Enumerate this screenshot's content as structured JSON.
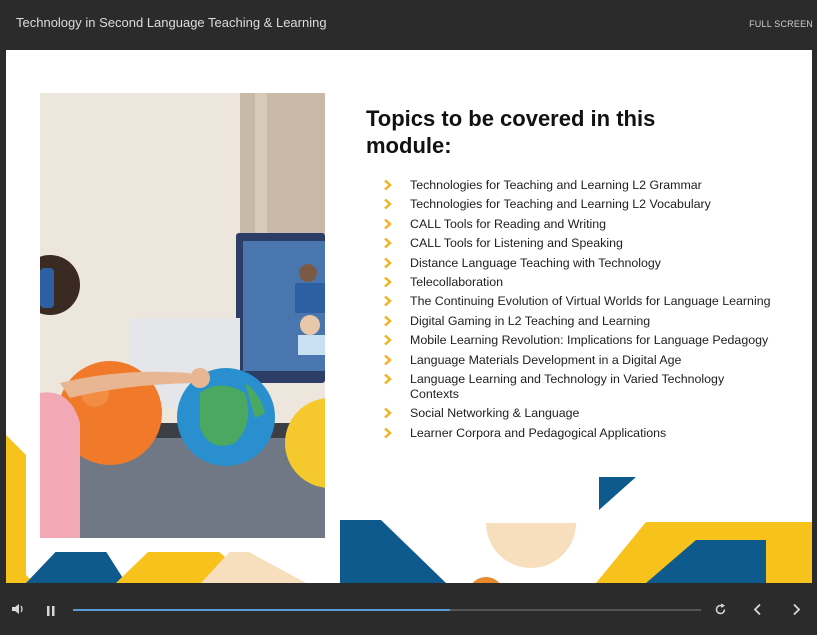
{
  "window": {
    "title": "Technology in Second Language Teaching & Learning",
    "fullscreen_label": "FULL SCREEN"
  },
  "slide": {
    "heading": "Topics to be covered in this module:",
    "topics": [
      "Technologies for Teaching and Learning L2 Grammar",
      "Technologies for Teaching and Learning L2 Vocabulary",
      "CALL Tools for Reading and Writing",
      "CALL Tools for Listening and Speaking",
      "Distance Language Teaching with Technology",
      "Telecollaboration",
      "The Continuing Evolution of Virtual Worlds for Language Learning",
      "Digital Gaming in L2 Teaching and Learning",
      "Mobile Learning Revolution: Implications for Language Pedagogy",
      "Language Materials Development in a Digital Age",
      "Language Learning and Technology in Varied Technology Contexts",
      "Social Networking & Language",
      "Learner Corpora and Pedagogical Applications"
    ],
    "colors": {
      "bullet": "#f2b21b",
      "navy": "#0f5a8c",
      "yellow": "#f7c21c",
      "peach": "#f7dfbd",
      "orange": "#e8892e"
    }
  },
  "player": {
    "progress": 0.6,
    "icons": {
      "volume": "volume-icon",
      "pause": "pause-icon",
      "replay": "replay-icon",
      "prev": "chevron-left-icon",
      "next": "chevron-right-icon"
    }
  }
}
